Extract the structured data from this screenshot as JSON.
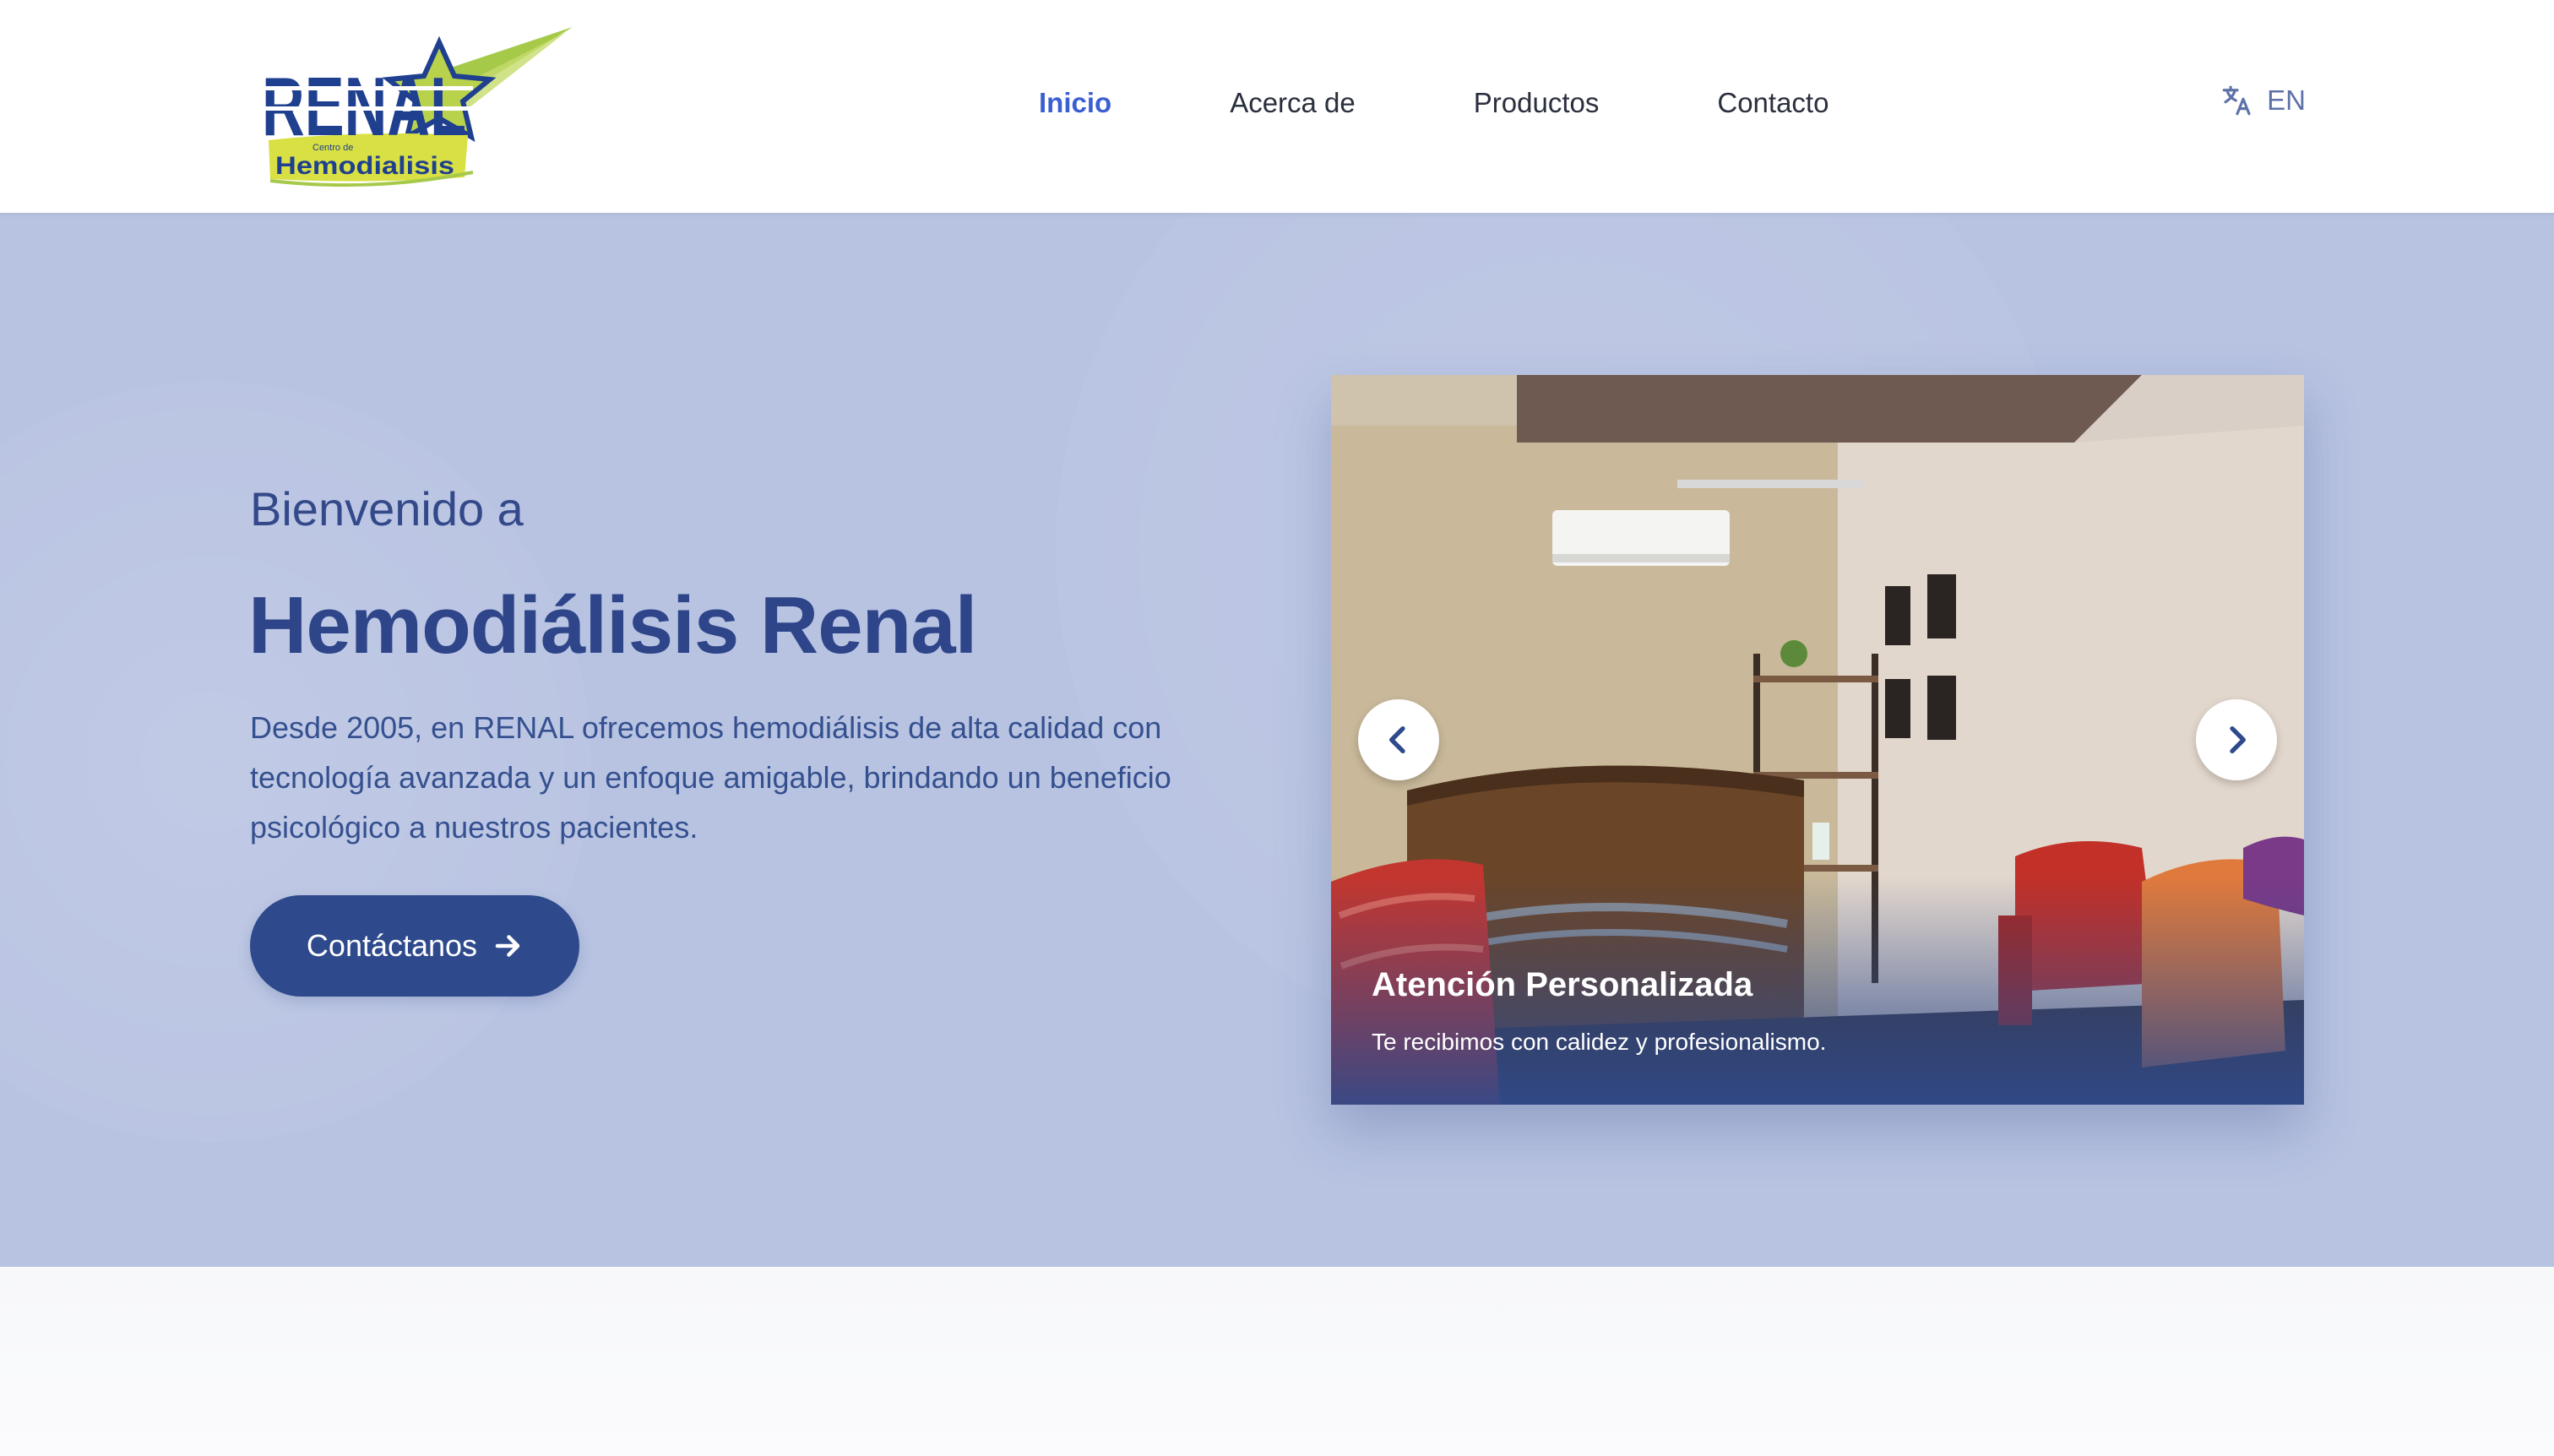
{
  "brand": {
    "logo_word": "RENAL",
    "logo_small": "Centro de",
    "logo_sub": "Hemodialisis",
    "colors": {
      "primary": "#2f4a8c",
      "accent_green": "#a6c94a",
      "active_link": "#3b5fd0",
      "hero_bg": "#b8c3e2"
    }
  },
  "nav": {
    "items": [
      {
        "label": "Inicio",
        "active": true
      },
      {
        "label": "Acerca de",
        "active": false
      },
      {
        "label": "Productos",
        "active": false
      },
      {
        "label": "Contacto",
        "active": false
      }
    ]
  },
  "language": {
    "icon": "translate-icon",
    "label": "EN"
  },
  "hero": {
    "welcome": "Bienvenido a",
    "title": "Hemodiálisis Renal",
    "description": "Desde 2005, en RENAL ofrecemos hemodiálisis de alta calidad con tecnología avanzada y un enfoque amigable, brindando un beneficio psicológico a nuestros pacientes.",
    "cta_label": "Contáctanos",
    "cta_icon": "arrow-right-icon"
  },
  "carousel": {
    "slide_title": "Atención Personalizada",
    "slide_subtitle": "Te recibimos con calidez y profesionalismo.",
    "prev_icon": "chevron-left-icon",
    "next_icon": "chevron-right-icon"
  }
}
